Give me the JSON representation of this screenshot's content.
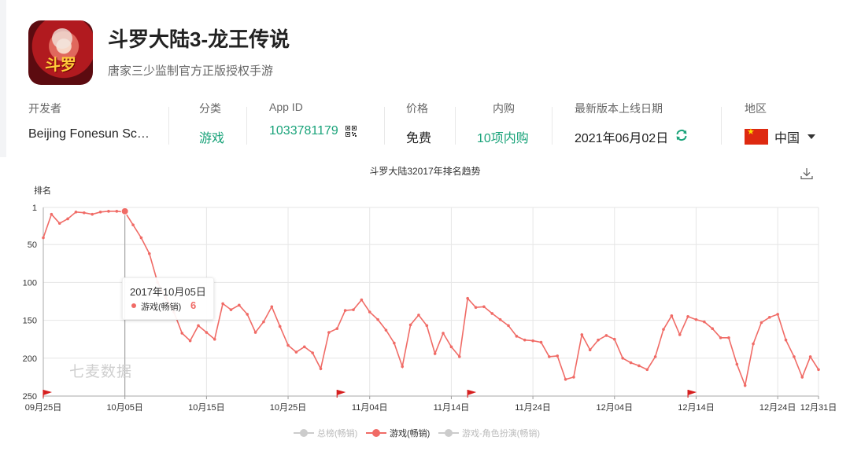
{
  "app": {
    "name": "斗罗大陆3-龙王传说",
    "subtitle": "唐家三少监制官方正版授权手游",
    "icon_text": "斗罗"
  },
  "meta": {
    "developer_label": "开发者",
    "developer_value": "Beijing Fonesun Sc…",
    "category_label": "分类",
    "category_value": "游戏",
    "appid_label": "App ID",
    "appid_value": "1033781179",
    "price_label": "价格",
    "price_value": "免费",
    "iap_label": "内购",
    "iap_value": "10项内购",
    "release_label": "最新版本上线日期",
    "release_value": "2021年06月02日",
    "region_label": "地区",
    "region_value": "中国"
  },
  "colors": {
    "accent_green": "#1aa37a",
    "series_red": "#f06b66",
    "inactive_gray": "#cccccc",
    "flag_red": "#de2910"
  },
  "tooltip": {
    "date": "2017年10月05日",
    "series": "游戏(畅销)",
    "value": "6"
  },
  "watermark": "七麦数据",
  "chart_data": {
    "type": "line",
    "title": "斗罗大陆32017年排名趋势",
    "ylabel": "排名",
    "y_inverted": true,
    "ylim": [
      1,
      250
    ],
    "y_ticks": [
      "1",
      "50",
      "100",
      "150",
      "200",
      "250"
    ],
    "x_tick_labels": [
      "09月25日",
      "10月05日",
      "10月15日",
      "10月25日",
      "11月04日",
      "11月14日",
      "11月24日",
      "12月04日",
      "12月14日",
      "12月24日",
      "12月31日"
    ],
    "x_start": "09月25日",
    "x_end": "12月31日",
    "grid": true,
    "legend_position": "bottom",
    "legend": [
      {
        "name": "总榜(畅销)",
        "active": false
      },
      {
        "name": "游戏(畅销)",
        "active": true
      },
      {
        "name": "游戏-角色扮演(畅销)",
        "active": false
      }
    ],
    "series": [
      {
        "name": "游戏(畅销)",
        "values": [
          41,
          10,
          22,
          16,
          7,
          8,
          10,
          7,
          6,
          6,
          7,
          24,
          41,
          62,
          100,
          120,
          139,
          167,
          177,
          157,
          166,
          175,
          128,
          136,
          130,
          142,
          166,
          152,
          132,
          158,
          183,
          192,
          185,
          193,
          214,
          166,
          161,
          137,
          136,
          123,
          139,
          149,
          163,
          180,
          211,
          156,
          143,
          157,
          194,
          167,
          185,
          198,
          121,
          133,
          132,
          141,
          149,
          157,
          171,
          176,
          177,
          179,
          198,
          197,
          228,
          225,
          169,
          189,
          176,
          170,
          175,
          200,
          206,
          210,
          215,
          198,
          162,
          144,
          169,
          145,
          149,
          152,
          161,
          173,
          173,
          208,
          236,
          181,
          153,
          146,
          142,
          176,
          198,
          225,
          198,
          215
        ]
      },
      {
        "name": "总榜(畅销)",
        "values": []
      },
      {
        "name": "游戏-角色扮演(畅销)",
        "values": []
      }
    ],
    "highlight": {
      "date": "10月05日",
      "value": 6
    },
    "event_flags": [
      "09月25日",
      "10月31日",
      "11月16日",
      "12月13日"
    ]
  }
}
